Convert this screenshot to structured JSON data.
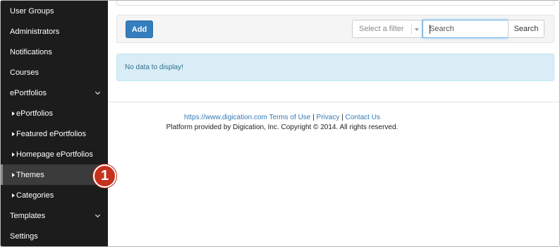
{
  "sidebar": {
    "items": [
      {
        "label": "User Groups",
        "type": "top"
      },
      {
        "label": "Administrators",
        "type": "top"
      },
      {
        "label": "Notifications",
        "type": "top"
      },
      {
        "label": "Courses",
        "type": "top"
      },
      {
        "label": "ePortfolios",
        "type": "top",
        "expandable": true,
        "expanded": true
      },
      {
        "label": "ePortfolios",
        "type": "sub"
      },
      {
        "label": "Featured ePortfolios",
        "type": "sub"
      },
      {
        "label": "Homepage ePortfolios",
        "type": "sub"
      },
      {
        "label": "Themes",
        "type": "sub",
        "active": true
      },
      {
        "label": "Categories",
        "type": "sub"
      },
      {
        "label": "Templates",
        "type": "top",
        "expandable": true
      },
      {
        "label": "Settings",
        "type": "top"
      }
    ]
  },
  "toolbar": {
    "add_label": "Add",
    "filter_placeholder": "Select a filter",
    "search_placeholder": "Search",
    "search_button": "Search"
  },
  "alert": {
    "message": "No data to display!"
  },
  "footer": {
    "link_terms": "https://www.digication.com Terms of Use",
    "separator": "|",
    "link_privacy": "Privacy",
    "link_contact": "Contact Us",
    "copyright": "Platform provided by Digication, Inc. Copyright © 2014. All rights reserved."
  },
  "annotation": {
    "step_number": "1"
  },
  "colors": {
    "sidebar_bg": "#1c1c1c",
    "primary_button": "#357ebd",
    "alert_bg": "#d9edf7",
    "badge": "#c7321f"
  }
}
